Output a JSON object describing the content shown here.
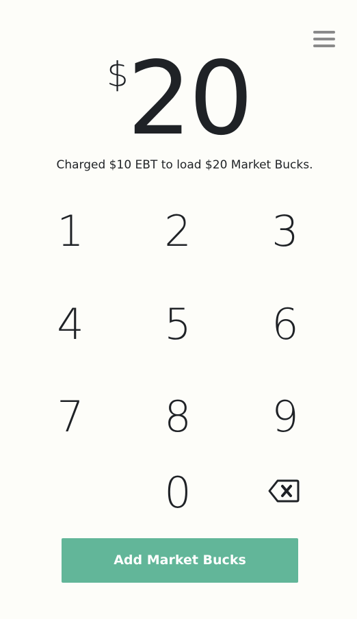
{
  "header": {
    "menu_icon": "hamburger-menu-icon"
  },
  "amount": {
    "currency": "$",
    "value": "20"
  },
  "summary": "Charged $10 EBT to load $20 Market Bucks.",
  "keypad": {
    "keys": [
      "1",
      "2",
      "3",
      "4",
      "5",
      "6",
      "7",
      "8",
      "9",
      "0"
    ],
    "backspace_icon": "backspace-icon"
  },
  "action": {
    "label": "Add Market Bucks",
    "color": "#62b699"
  }
}
